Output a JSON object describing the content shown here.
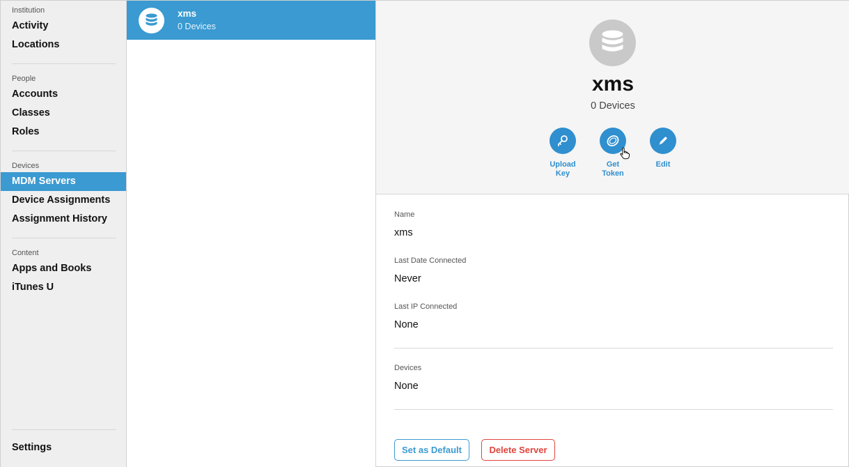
{
  "sidebar": {
    "sections": [
      {
        "header": "Institution",
        "items": [
          "Activity",
          "Locations"
        ]
      },
      {
        "header": "People",
        "items": [
          "Accounts",
          "Classes",
          "Roles"
        ]
      },
      {
        "header": "Devices",
        "items": [
          "MDM Servers",
          "Device Assignments",
          "Assignment History"
        ]
      },
      {
        "header": "Content",
        "items": [
          "Apps and Books",
          "iTunes U"
        ]
      }
    ],
    "active_item": "MDM Servers",
    "settings_label": "Settings"
  },
  "server_list": [
    {
      "name": "xms",
      "subtitle": "0 Devices",
      "icon": "database-icon"
    }
  ],
  "detail": {
    "title": "xms",
    "subtitle": "0 Devices",
    "actions": [
      {
        "label_line1": "Upload",
        "label_line2": "Key",
        "icon": "key-icon"
      },
      {
        "label_line1": "Get",
        "label_line2": "Token",
        "icon": "token-icon"
      },
      {
        "label_line1": "Edit",
        "label_line2": "",
        "icon": "pencil-icon"
      }
    ],
    "fields": [
      {
        "label": "Name",
        "value": "xms"
      },
      {
        "label": "Last Date Connected",
        "value": "Never"
      },
      {
        "label": "Last IP Connected",
        "value": "None"
      },
      {
        "label": "Devices",
        "value": "None"
      }
    ],
    "buttons": {
      "set_default": "Set as Default",
      "delete": "Delete Server"
    }
  },
  "colors": {
    "accent": "#3a9ad1",
    "danger": "#e0443c",
    "sidebar_bg": "#efefef"
  }
}
